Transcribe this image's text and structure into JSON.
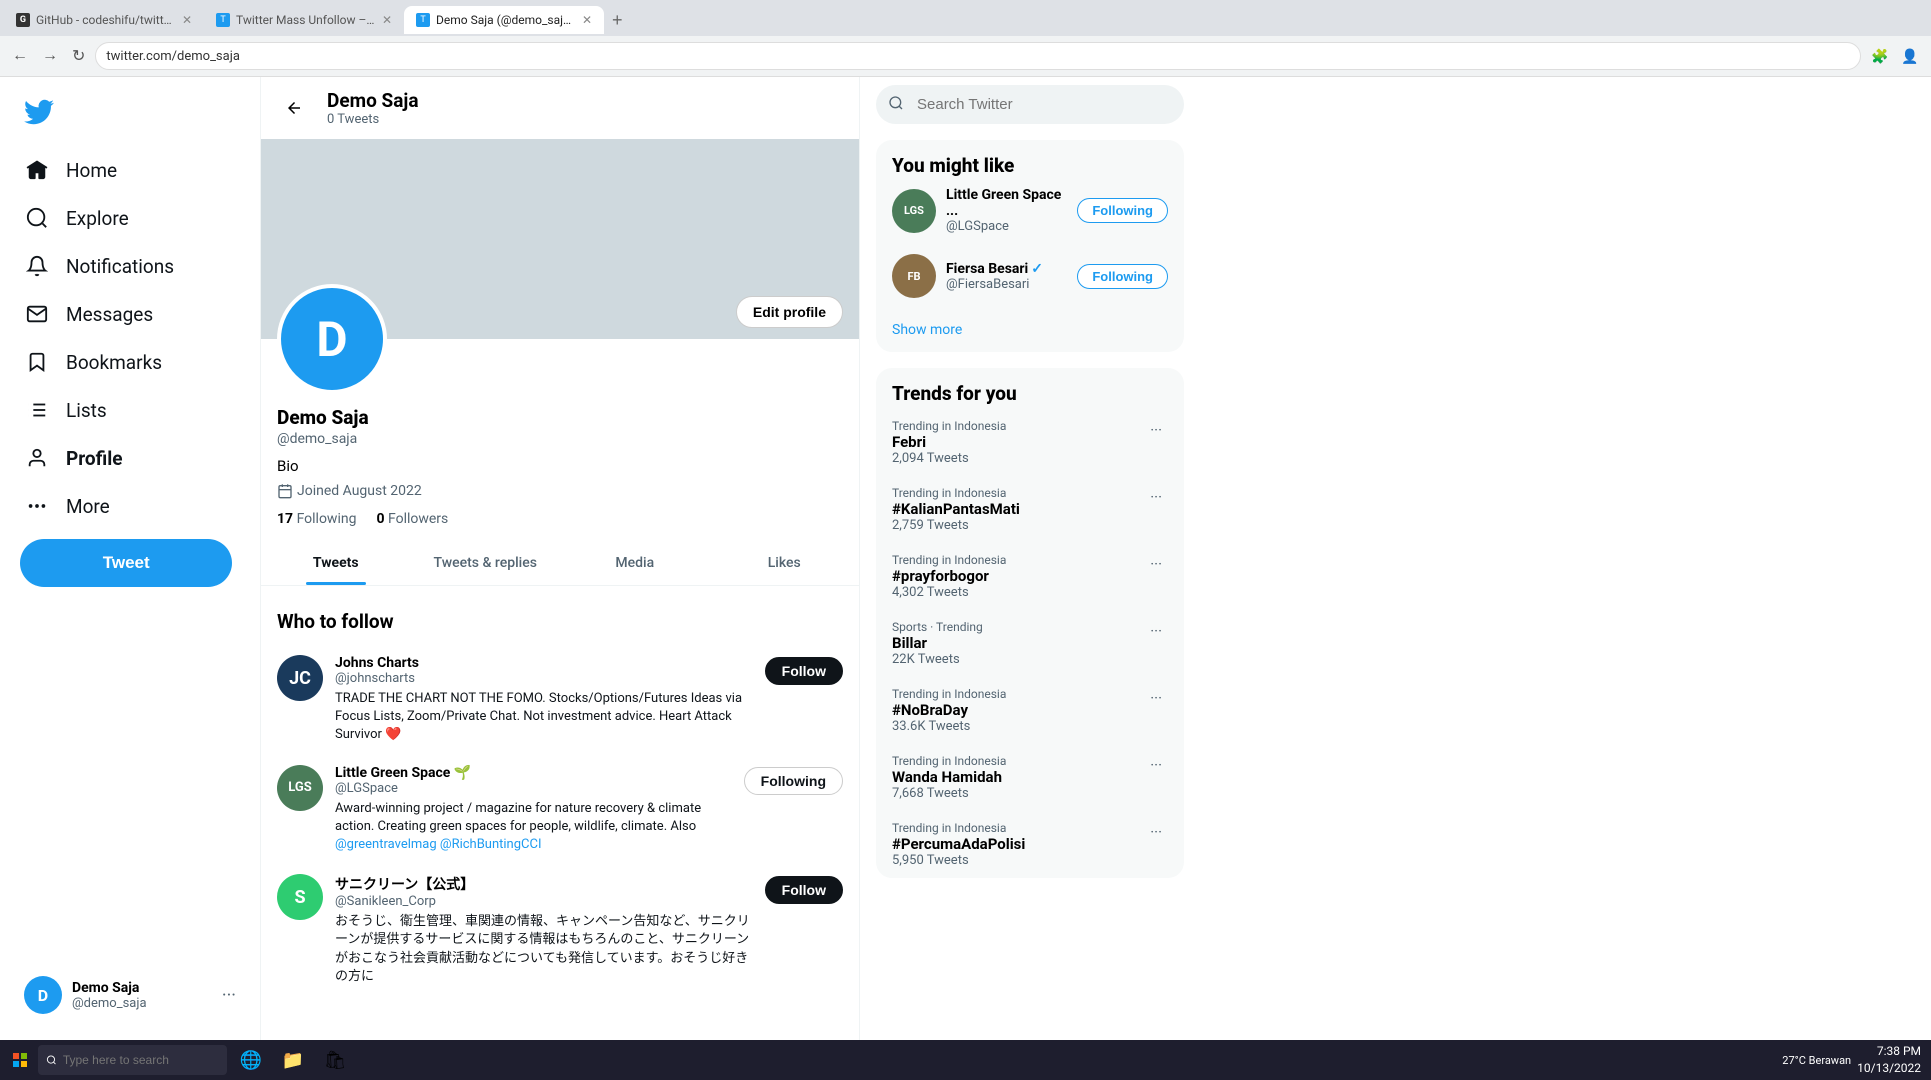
{
  "browser": {
    "tabs": [
      {
        "id": "tab1",
        "label": "GitHub - codeshifu/twitter-mass...",
        "favicon_color": "#333",
        "favicon_letter": "G",
        "active": false
      },
      {
        "id": "tab2",
        "label": "Twitter Mass Unfollow – Chrome...",
        "favicon_color": "#1d9bf0",
        "favicon_letter": "T",
        "active": false
      },
      {
        "id": "tab3",
        "label": "Demo Saja (@demo_saja) / Twitt...",
        "favicon_color": "#1d9bf0",
        "favicon_letter": "T",
        "active": true
      }
    ],
    "url": "twitter.com/demo_saja"
  },
  "sidebar": {
    "items": [
      {
        "id": "home",
        "label": "Home"
      },
      {
        "id": "explore",
        "label": "Explore"
      },
      {
        "id": "notifications",
        "label": "Notifications"
      },
      {
        "id": "messages",
        "label": "Messages"
      },
      {
        "id": "bookmarks",
        "label": "Bookmarks"
      },
      {
        "id": "lists",
        "label": "Lists"
      },
      {
        "id": "profile",
        "label": "Profile"
      },
      {
        "id": "more",
        "label": "More"
      }
    ],
    "tweet_button": "Tweet",
    "user": {
      "name": "Demo Saja",
      "handle": "@demo_saja",
      "avatar_letter": "D"
    }
  },
  "profile": {
    "back_button": "←",
    "name": "Demo Saja",
    "tweets_count": "0 Tweets",
    "handle": "@demo_saja",
    "bio": "Bio",
    "joined": "Joined August 2022",
    "following_count": "17",
    "following_label": "Following",
    "followers_count": "0",
    "followers_label": "Followers",
    "edit_button": "Edit profile",
    "avatar_letter": "D"
  },
  "tabs": [
    {
      "id": "tweets",
      "label": "Tweets",
      "active": true
    },
    {
      "id": "tweets_replies",
      "label": "Tweets & replies",
      "active": false
    },
    {
      "id": "media",
      "label": "Media",
      "active": false
    },
    {
      "id": "likes",
      "label": "Likes",
      "active": false
    }
  ],
  "who_to_follow": {
    "title": "Who to follow",
    "items": [
      {
        "id": "johns_charts",
        "name": "Johns Charts",
        "handle": "@johnscharts",
        "bio": "TRADE THE CHART NOT THE FOMO. Stocks/Options/Futures Ideas via Focus Lists, Zoom/Private Chat. Not investment advice. Heart Attack Survivor ❤️",
        "avatar_color": "#1a3a5c",
        "avatar_letter": "JC",
        "button": "Follow",
        "is_following": false
      },
      {
        "id": "lgs",
        "name": "Little Green Space 🌱",
        "handle": "@LGSpace",
        "bio": "Award-winning project / magazine for nature recovery & climate action. Creating green spaces for people, wildlife, climate. Also @greentravelmag @RichBuntingCCI",
        "avatar_color": "#4a7c59",
        "avatar_letter": "LGS",
        "button": "Following",
        "is_following": true
      },
      {
        "id": "sanikleen",
        "name": "サニクリーン【公式】",
        "handle": "@Sanikleen_Corp",
        "bio": "おそうじ、衛生管理、車関連の情報、キャンペーン告知など、サニクリーンが提供するサービスに関する情報はもちろんのこと、サニクリーンがおこなう社会貢献活動などについても発信しています。おそうじ好きの方に",
        "avatar_color": "#2ecc71",
        "avatar_letter": "S",
        "button": "Follow",
        "is_following": false
      }
    ]
  },
  "right_sidebar": {
    "search_placeholder": "Search Twitter",
    "you_might_like": {
      "title": "You might like",
      "items": [
        {
          "id": "lgs",
          "name": "Little Green Space ...",
          "handle": "@LGSpace",
          "avatar_color": "#4a7c59",
          "avatar_letter": "LGS",
          "button": "Following",
          "is_following": true
        },
        {
          "id": "fiersa",
          "name": "Fiersa Besari",
          "handle": "@FiersaBesari",
          "verified": true,
          "avatar_color": "#8b6f47",
          "avatar_letter": "FB",
          "button": "Following",
          "is_following": true
        }
      ],
      "show_more": "Show more"
    },
    "trends": {
      "title": "Trends for you",
      "items": [
        {
          "id": "febri",
          "context": "Trending in Indonesia",
          "name": "Febri",
          "count": "2,094 Tweets"
        },
        {
          "id": "kalian",
          "context": "Trending in Indonesia",
          "name": "#KalianPantasMati",
          "count": "2,759 Tweets"
        },
        {
          "id": "pray",
          "context": "Trending in Indonesia",
          "name": "#prayforbogor",
          "count": "4,302 Tweets"
        },
        {
          "id": "billar",
          "context": "Sports · Trending",
          "name": "Billar",
          "count": "22K Tweets"
        },
        {
          "id": "nobra",
          "context": "Trending in Indonesia",
          "name": "#NoBraDay",
          "count": "33.6K Tweets"
        },
        {
          "id": "wanda",
          "context": "Trending in Indonesia",
          "name": "Wanda Hamidah",
          "count": "7,668 Tweets"
        },
        {
          "id": "percuma",
          "context": "Trending in Indonesia",
          "name": "#PercumaAdaPolisi",
          "count": "5,950 Tweets"
        }
      ]
    }
  },
  "taskbar": {
    "search_placeholder": "Type here to search",
    "time": "7:38 PM",
    "date": "10/13/2022",
    "weather": "27°C  Berawan"
  }
}
